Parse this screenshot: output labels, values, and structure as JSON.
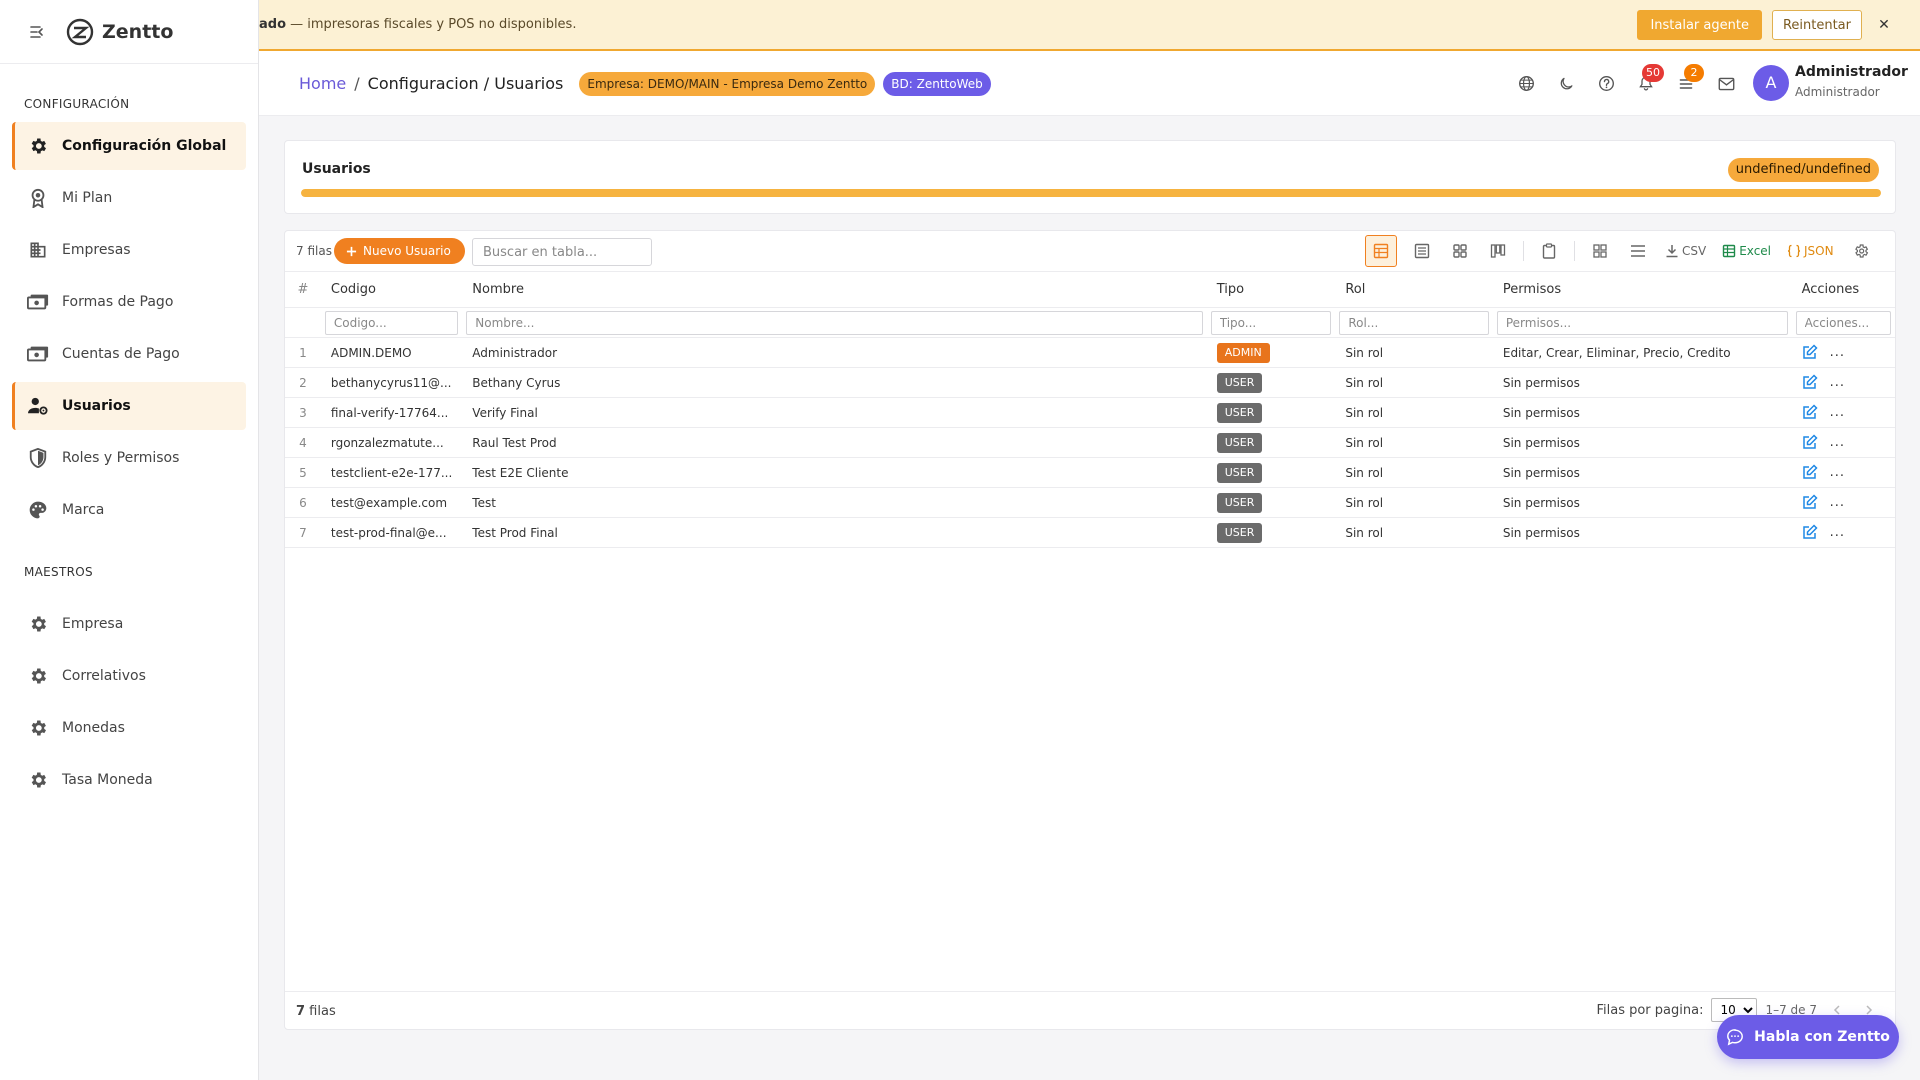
{
  "alert": {
    "bold": "ado",
    "message": " — impresoras fiscales y POS no disponibles.",
    "install_label": "Instalar agente",
    "retry_label": "Reintentar",
    "close": "✕"
  },
  "sidebar": {
    "brand": "Zentto",
    "sections": [
      {
        "title": "CONFIGURACIÓN",
        "items": [
          {
            "label": "Configuración Global",
            "icon": "gear-icon",
            "active": true
          },
          {
            "label": "Mi Plan",
            "icon": "award-icon"
          },
          {
            "label": "Empresas",
            "icon": "building-icon"
          },
          {
            "label": "Formas de Pago",
            "icon": "payments-icon"
          },
          {
            "label": "Cuentas de Pago",
            "icon": "payments-icon"
          },
          {
            "label": "Usuarios",
            "icon": "user-settings-icon",
            "active": true
          },
          {
            "label": "Roles y Permisos",
            "icon": "shield-icon"
          },
          {
            "label": "Marca",
            "icon": "palette-icon"
          }
        ]
      },
      {
        "title": "MAESTROS",
        "items": [
          {
            "label": "Empresa",
            "icon": "gear-icon"
          },
          {
            "label": "Correlativos",
            "icon": "gear-icon"
          },
          {
            "label": "Monedas",
            "icon": "gear-icon"
          },
          {
            "label": "Tasa Moneda",
            "icon": "gear-icon"
          }
        ]
      }
    ]
  },
  "header": {
    "breadcrumb_home": "Home",
    "breadcrumb_sep": "/",
    "breadcrumb_current": "Configuracion / Usuarios",
    "empresa_chip": "Empresa: DEMO/MAIN - Empresa Demo Zentto",
    "bd_chip": "BD: ZenttoWeb",
    "notifications_count": "50",
    "tasks_count": "2",
    "avatar_letter": "A",
    "user_name": "Administrador",
    "user_role": "Administrador"
  },
  "title_card": {
    "title": "Usuarios",
    "pill": "undefined/undefined",
    "progress": 1.0
  },
  "grid": {
    "row_count_label": "7 filas",
    "new_button": "Nuevo Usuario",
    "search_placeholder": "Buscar en tabla...",
    "export_csv": "CSV",
    "export_excel": "Excel",
    "export_json": "JSON",
    "columns": {
      "idx": "#",
      "codigo": "Codigo",
      "nombre": "Nombre",
      "tipo": "Tipo",
      "rol": "Rol",
      "permisos": "Permisos",
      "acciones": "Acciones"
    },
    "filters": {
      "codigo": "Codigo...",
      "nombre": "Nombre...",
      "tipo": "Tipo...",
      "rol": "Rol...",
      "permisos": "Permisos...",
      "acciones": "Acciones..."
    },
    "rows": [
      {
        "idx": "1",
        "codigo": "ADMIN.DEMO",
        "nombre": "Administrador",
        "tipo": "ADMIN",
        "rol": "Sin rol",
        "permisos": "Editar, Crear, Eliminar, Precio, Credito"
      },
      {
        "idx": "2",
        "codigo": "bethanycyrus11@...",
        "nombre": "Bethany Cyrus",
        "tipo": "USER",
        "rol": "Sin rol",
        "permisos": "Sin permisos"
      },
      {
        "idx": "3",
        "codigo": "final-verify-17764...",
        "nombre": "Verify Final",
        "tipo": "USER",
        "rol": "Sin rol",
        "permisos": "Sin permisos"
      },
      {
        "idx": "4",
        "codigo": "rgonzalezmatute...",
        "nombre": "Raul Test Prod",
        "tipo": "USER",
        "rol": "Sin rol",
        "permisos": "Sin permisos"
      },
      {
        "idx": "5",
        "codigo": "testclient-e2e-177...",
        "nombre": "Test E2E Cliente",
        "tipo": "USER",
        "rol": "Sin rol",
        "permisos": "Sin permisos"
      },
      {
        "idx": "6",
        "codigo": "test@example.com",
        "nombre": "Test",
        "tipo": "USER",
        "rol": "Sin rol",
        "permisos": "Sin permisos"
      },
      {
        "idx": "7",
        "codigo": "test-prod-final@e...",
        "nombre": "Test Prod Final",
        "tipo": "USER",
        "rol": "Sin rol",
        "permisos": "Sin permisos"
      }
    ],
    "more_label": "...",
    "footer_count": "7",
    "footer_count_suffix": " filas",
    "rows_per_page_label": "Filas por pagina:",
    "rows_per_page": "10",
    "range": "1–7 de 7"
  },
  "chat": {
    "label": "Habla con Zentto"
  },
  "colors": {
    "accent": "#f08020",
    "brand_purple": "#6c5ce7",
    "admin_badge": "#e8741c",
    "user_badge": "#6b6b6b",
    "link": "#6a5ad8"
  }
}
